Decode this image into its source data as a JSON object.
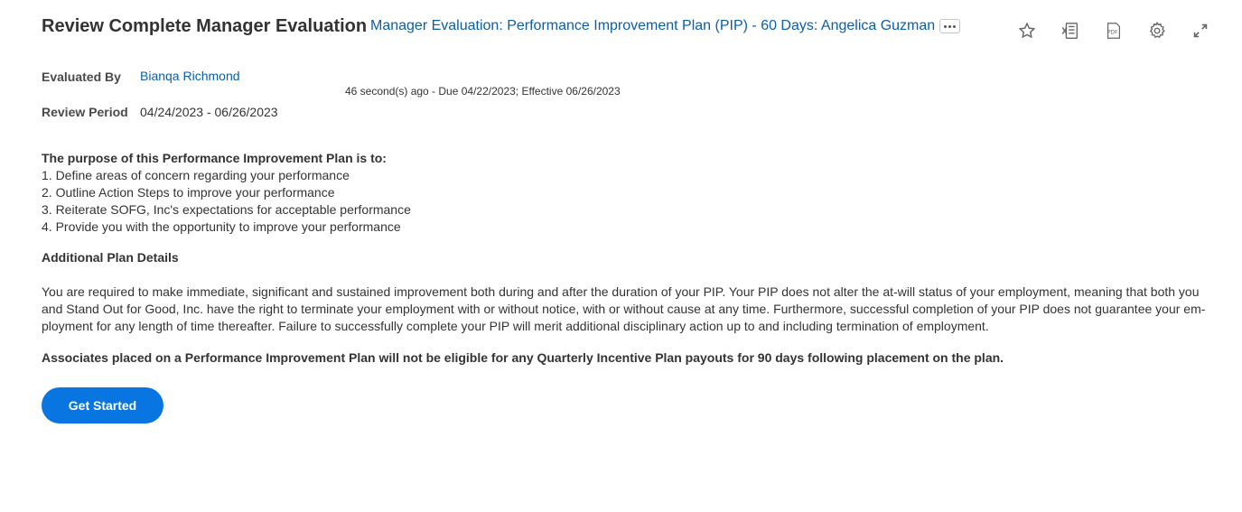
{
  "header": {
    "title": "Review Complete Manager Evaluation",
    "subtitle_link": "Manager Evaluation: Performance Improvement Plan (PIP) - 60 Days: Angelica Guzman",
    "more_button_icon": "ellipsis-icon",
    "toolbar_icons": [
      "star-icon",
      "excel-export-icon",
      "pdf-export-icon",
      "gear-icon",
      "fullscreen-icon"
    ]
  },
  "fields": {
    "evaluated_by_label": "Evaluated By",
    "evaluated_by_value": "Bianqa Richmond",
    "review_period_label": "Review Period",
    "review_period_value": "04/24/2023 - 06/26/2023"
  },
  "status": "46 second(s) ago - Due 04/22/2023; Effective 06/26/2023",
  "content": {
    "purpose_heading": "The purpose of this Performance Improvement Plan is to:",
    "purpose_items": [
      "1. Define areas of concern regarding your performance",
      "2. Outline Action Steps to improve your performance",
      "3. Reiterate SOFG, Inc's expectations for acceptable performance",
      "4. Provide you with the opportunity to improve your performance"
    ],
    "additional_heading": "Additional Plan Details",
    "body_paragraph": "You are required to make immediate, significant and sustained improvement both during and after the duration of your PIP. Your PIP does not alter the at-will status of your employment, meaning that both you and Stand Out for Good, Inc. have the right to terminate your employment with or without notice, with or without cause at any time. Furthermore, successful completion of your PIP does not guarantee your em-ployment for any length of time thereafter. Failure to successfully complete your PIP will merit additional disciplinary action up to and including termination of employment.",
    "bold_note": "Associates placed on a Performance Improvement Plan will not be eligible for any Quarterly Incentive Plan payouts for 90 days following placement on the plan."
  },
  "actions": {
    "get_started_label": "Get Started"
  },
  "colors": {
    "link": "#0b5ea8",
    "primary_button": "#0875e1",
    "text": "#333333"
  }
}
